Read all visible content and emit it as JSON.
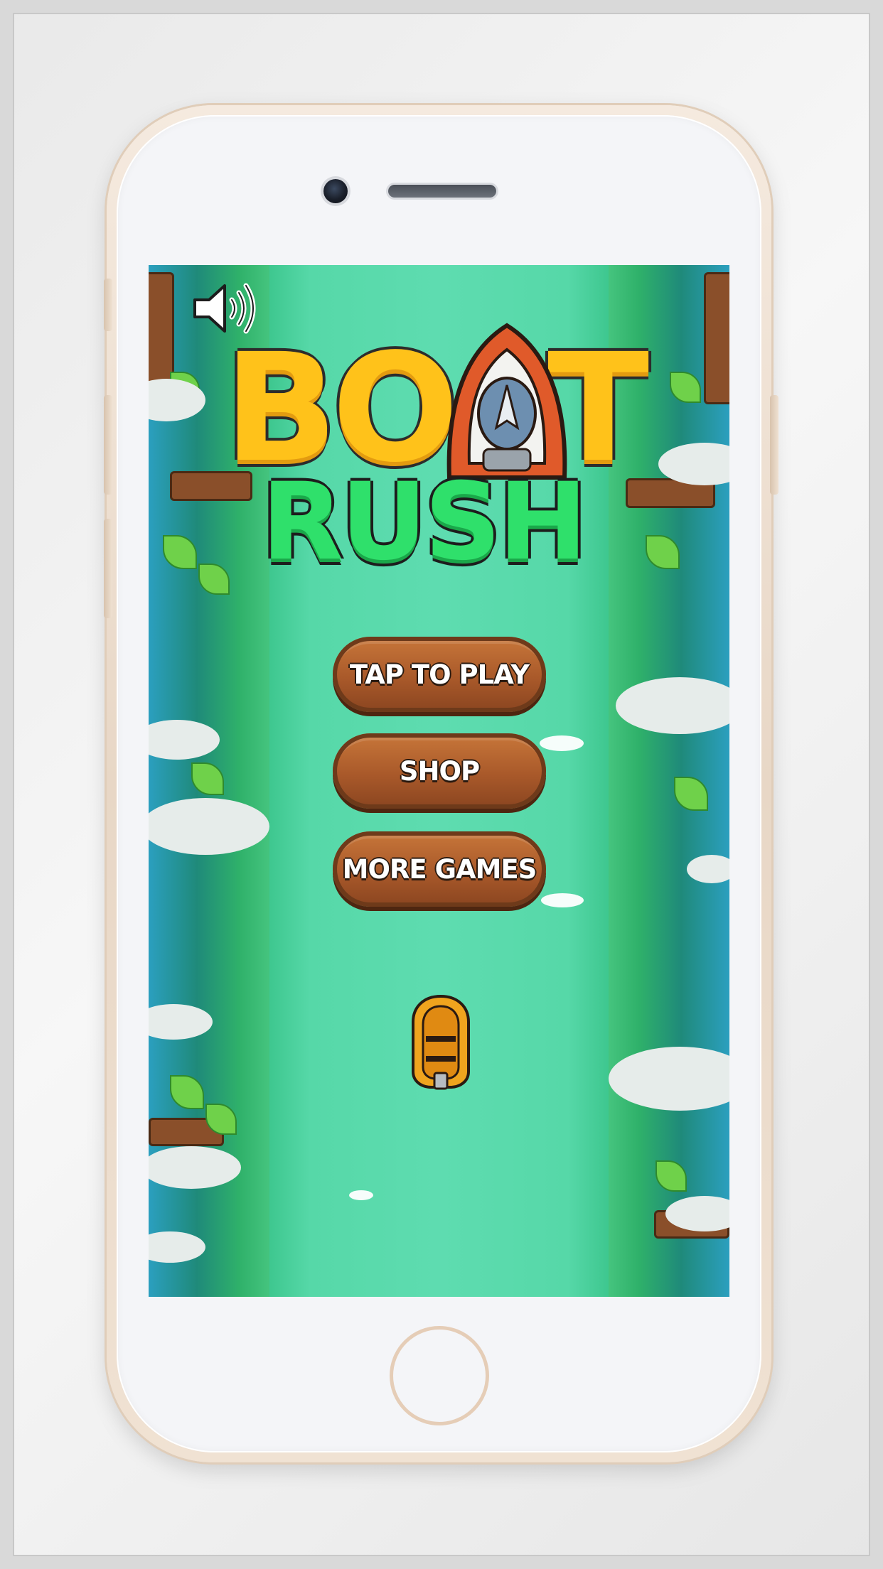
{
  "game": {
    "title_line1": "BOAT",
    "title_line2": "RUSH",
    "menu": {
      "play": "TAP TO PLAY",
      "shop": "SHOP",
      "more_games": "MORE GAMES"
    },
    "sound": "on"
  },
  "colors": {
    "river": "#4ed19e",
    "title_yellow": "#ffc21a",
    "title_green": "#2fe06b",
    "button_wood": "#a9592a",
    "boat_orange": "#f0a41e",
    "phone_gold": "#e8d7c6"
  },
  "icons": {
    "sound": "speaker-volume-icon",
    "player": "rubber-boat-icon"
  }
}
